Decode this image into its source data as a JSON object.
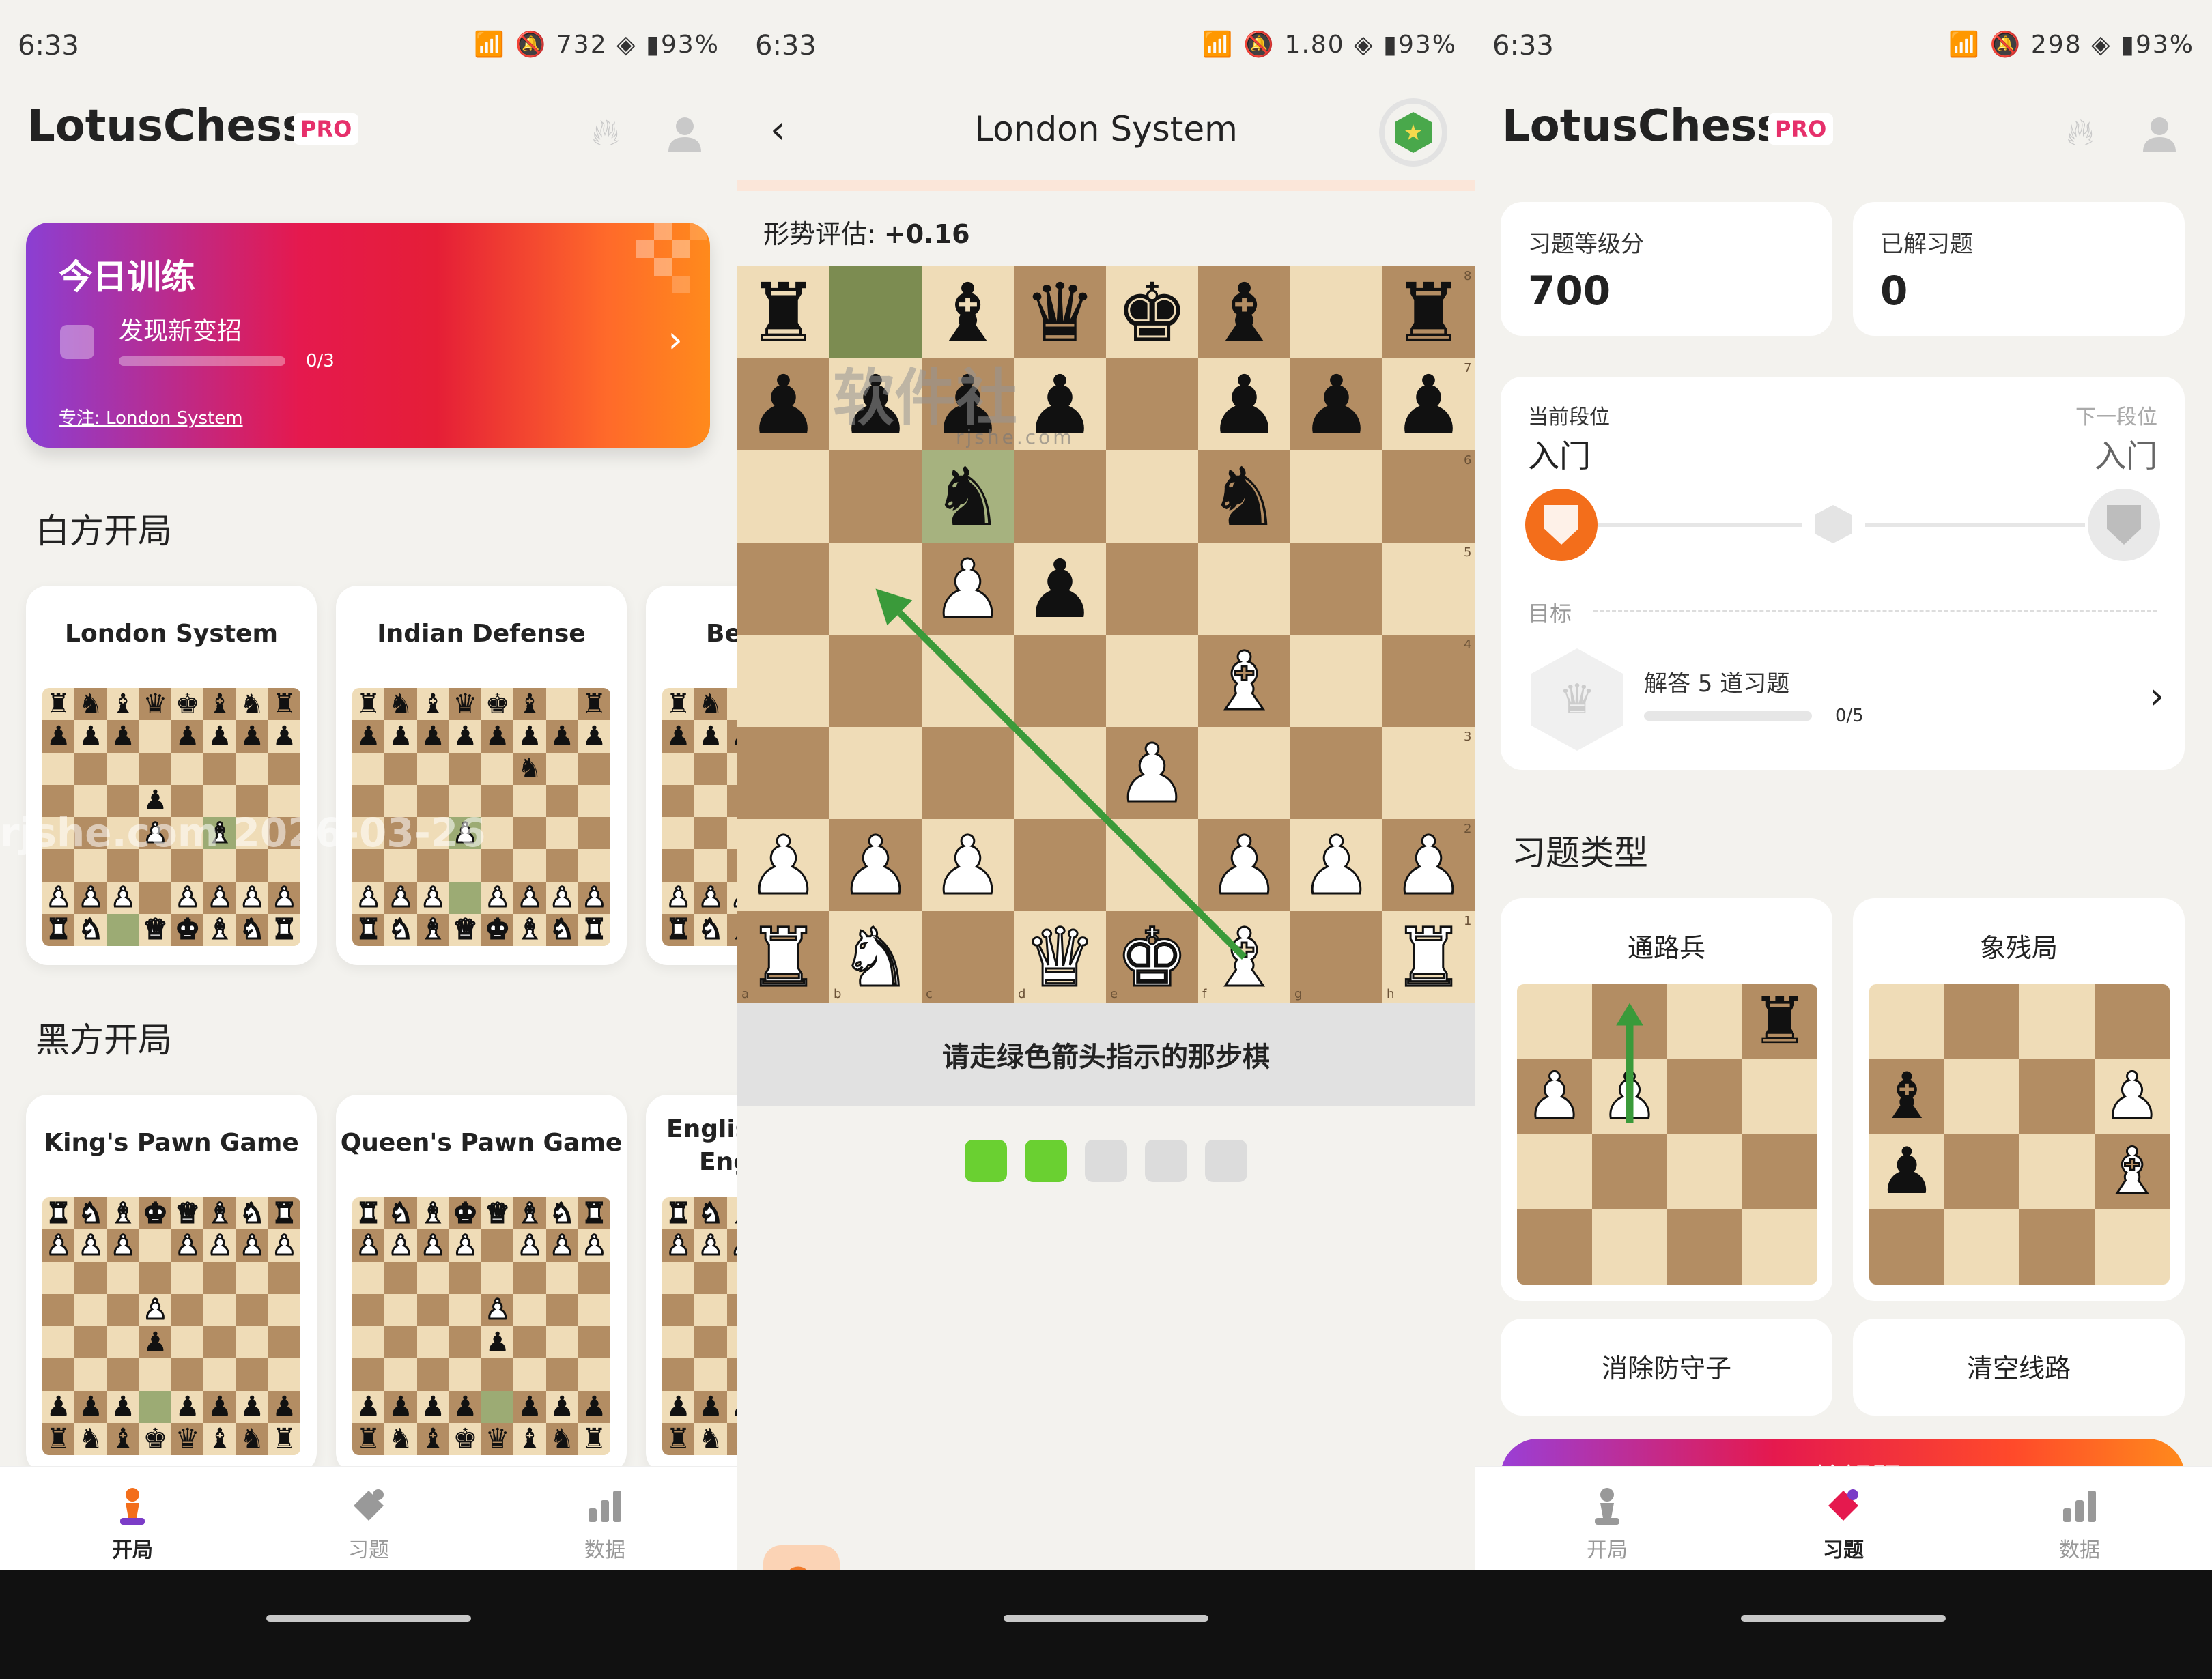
{
  "status": {
    "time": "6:33",
    "s1_icons": "📶 🔕 732 ◈ ▮93%",
    "s2_icons": "📶 🔕 1.80 ◈ ▮93%",
    "s3_icons": "📶 🔕 298 ◈ ▮93%"
  },
  "home": {
    "brand": "LotusChess",
    "pro": "PRO",
    "banner": {
      "title": "今日训练",
      "task": "发现新变招",
      "count": "0/3",
      "focus": "专注: London System"
    },
    "white_title": "白方开局",
    "black_title": "黑方开局",
    "white_openings": [
      "London System",
      "Indian Defense",
      "Be"
    ],
    "black_openings": [
      "King's Pawn Game",
      "Queen's Pawn Game",
      "English"
    ],
    "black_opening_3_sub": "Eng"
  },
  "tabs": [
    {
      "label": "开局",
      "icon": "pawn-icon"
    },
    {
      "label": "习题",
      "icon": "puzzle-icon"
    },
    {
      "label": "数据",
      "icon": "stats-icon"
    }
  ],
  "lesson": {
    "title": "London System",
    "eval_label": "形势评估:",
    "eval_value": "+0.16",
    "hint": "请走绿色箭头指示的那步棋",
    "progress": {
      "done": 2,
      "total": 5
    },
    "ranks": [
      "8",
      "7",
      "6",
      "5",
      "4",
      "3",
      "2",
      "1"
    ],
    "files": [
      "a",
      "b",
      "c",
      "d",
      "e",
      "f",
      "g",
      "h"
    ],
    "board": [
      "r.bqkb.r",
      "pppp.ppp",
      "..n..n..",
      "..Pp....",
      ".....B..",
      "....P...",
      "PPP..PPP",
      "RN.QKB.R"
    ],
    "arrow": {
      "from": "f1",
      "to": "b5",
      "color": "#3a9a3a"
    },
    "highlight": [
      "b8",
      "c6"
    ]
  },
  "puzzles": {
    "rating_label": "习题等级分",
    "rating_value": "700",
    "solved_label": "已解习题",
    "solved_value": "0",
    "current_rank_label": "当前段位",
    "current_rank": "入门",
    "next_rank_label": "下一段位",
    "next_rank": "入门",
    "goal_label": "目标",
    "goal_text": "解答 5 道习题",
    "goal_count": "0/5",
    "types_title": "习题类型",
    "types": [
      "通路兵",
      "象残局",
      "消除防守子",
      "清空线路"
    ],
    "start": "开始解题"
  },
  "colors": {
    "accent": "#f36e1b",
    "board_light": "#efdcb7",
    "board_dark": "#b38d63",
    "progress_green": "#6ad031",
    "pro_pink": "#e6306b"
  },
  "watermark": {
    "logo": "软件社",
    "url": "rjshe.com",
    "diag": "rjshe.com 2026-03-26"
  }
}
